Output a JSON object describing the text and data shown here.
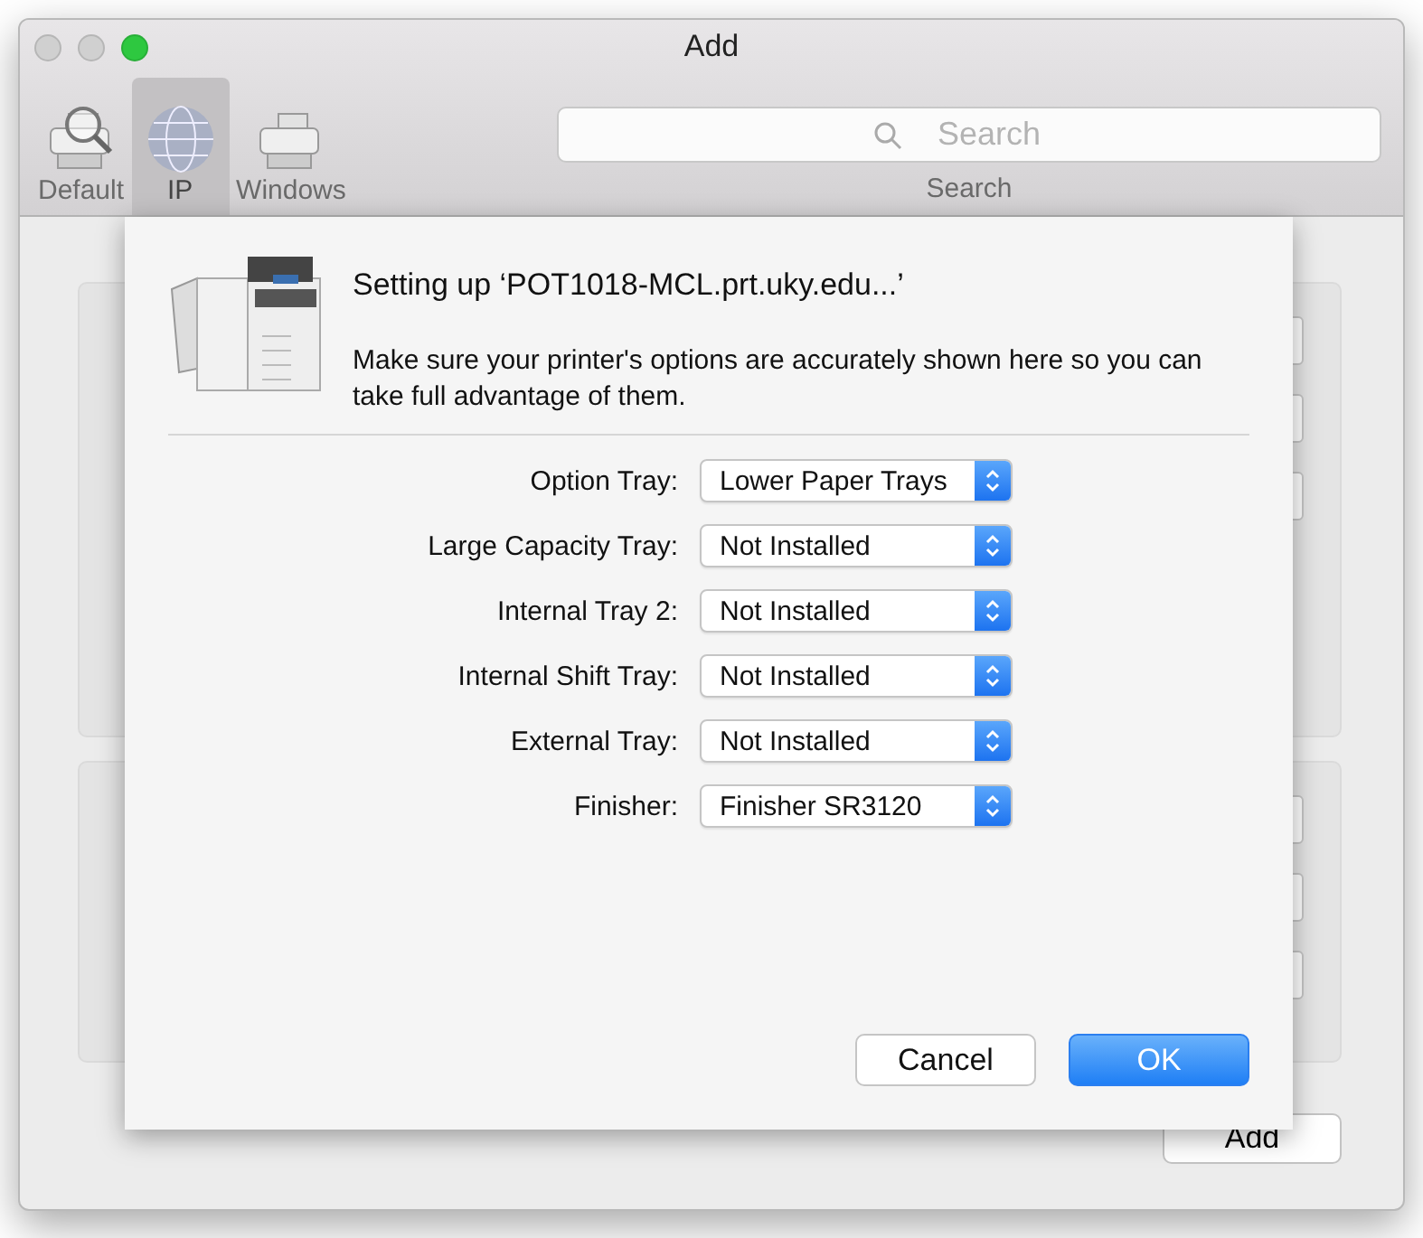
{
  "window": {
    "title": "Add"
  },
  "toolbar": {
    "items": [
      {
        "label": "Default",
        "kind": "default",
        "selected": false
      },
      {
        "label": "IP",
        "kind": "ip",
        "selected": true
      },
      {
        "label": "Windows",
        "kind": "windows",
        "selected": false
      }
    ],
    "search": {
      "placeholder": "Search",
      "label": "Search"
    }
  },
  "background": {
    "add_button": "Add"
  },
  "sheet": {
    "title": "Setting up ‘POT1018-MCL.prt.uky.edu...’",
    "message": "Make sure your printer's options are accurately shown here so you can take full advantage of them.",
    "options": [
      {
        "label": "Option Tray:",
        "value": "Lower Paper Trays"
      },
      {
        "label": "Large Capacity Tray:",
        "value": "Not Installed"
      },
      {
        "label": "Internal Tray 2:",
        "value": "Not Installed"
      },
      {
        "label": "Internal Shift Tray:",
        "value": "Not Installed"
      },
      {
        "label": "External Tray:",
        "value": "Not Installed"
      },
      {
        "label": "Finisher:",
        "value": "Finisher SR3120"
      }
    ],
    "buttons": [
      {
        "label": "Cancel",
        "kind": "secondary"
      },
      {
        "label": "OK",
        "kind": "primary"
      }
    ]
  }
}
